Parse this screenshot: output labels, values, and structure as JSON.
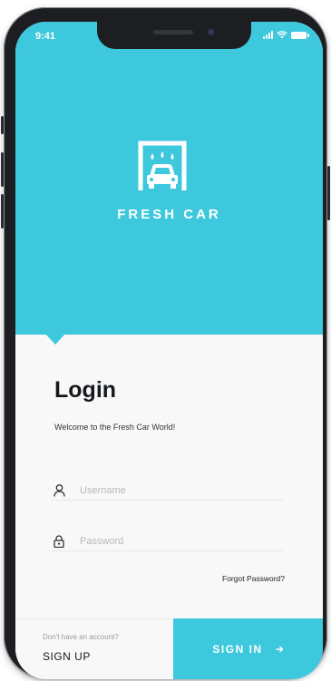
{
  "status_bar": {
    "time": "9:41",
    "icons": [
      "signal-icon",
      "wifi-icon",
      "battery-icon"
    ]
  },
  "brand": {
    "name": "FRESH CAR",
    "logo_icon": "car-wash-icon",
    "color": "#3ec8dd"
  },
  "login": {
    "title": "Login",
    "welcome": "Welcome to the Fresh Car World!",
    "username_placeholder": "Username",
    "username_value": "",
    "password_placeholder": "Password",
    "password_value": "",
    "forgot_label": "Forgot Password?"
  },
  "footer": {
    "prompt": "Don't have an account?",
    "signup_label": "SIGN UP",
    "signin_label": "SIGN IN",
    "signin_icon": "arrow-right-icon"
  }
}
